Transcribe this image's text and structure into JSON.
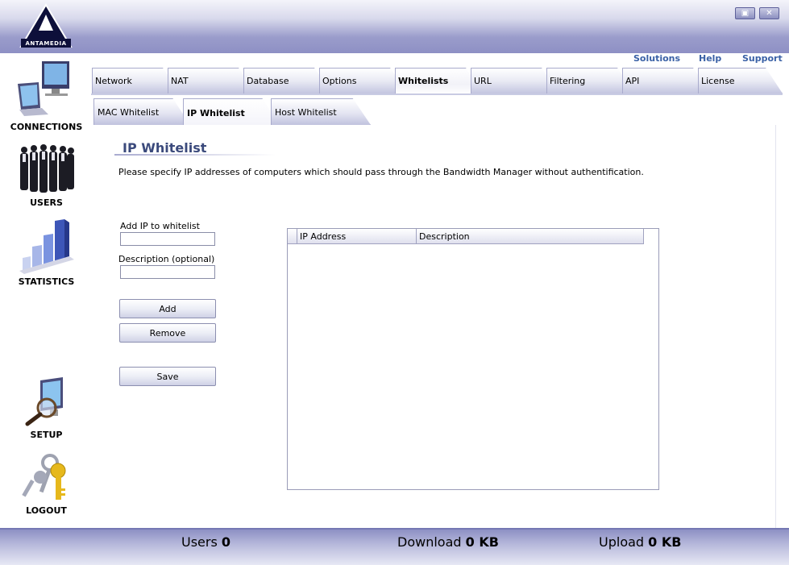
{
  "app": {
    "logo_text": "ANTAMEDIA"
  },
  "top_links": {
    "solutions": "Solutions",
    "help": "Help",
    "support": "Support"
  },
  "nav": {
    "connections": "CONNECTIONS",
    "users": "USERS",
    "statistics": "STATISTICS",
    "setup": "SETUP",
    "logout": "LOGOUT"
  },
  "tabs": [
    "Network",
    "NAT",
    "Database",
    "Options",
    "Whitelists",
    "URL",
    "Filtering",
    "API",
    "License"
  ],
  "active_tab": "Whitelists",
  "subtabs": [
    "MAC Whitelist",
    "IP Whitelist",
    "Host Whitelist"
  ],
  "active_subtab": "IP Whitelist",
  "page": {
    "title": "IP Whitelist",
    "description": "Please specify IP addresses of computers which should pass through the Bandwidth Manager without authentification."
  },
  "form": {
    "ip_label": "Add IP to whitelist",
    "ip_value": "",
    "desc_label": "Description (optional)",
    "desc_value": "",
    "add_button": "Add",
    "remove_button": "Remove",
    "save_button": "Save"
  },
  "list": {
    "columns": [
      "IP Address",
      "Description"
    ],
    "rows": []
  },
  "status": {
    "users_label": "Users",
    "users_value": "0",
    "download_label": "Download",
    "download_value": "0 KB",
    "upload_label": "Upload",
    "upload_value": "0 KB"
  },
  "colors": {
    "accent": "#3a61a6",
    "title": "#3b4a7c",
    "bar": "#8e90c4"
  }
}
